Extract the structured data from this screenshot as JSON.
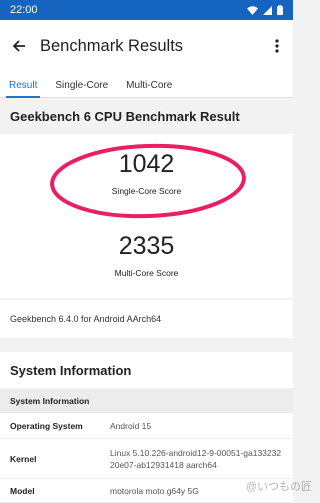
{
  "status_bar": {
    "time": "22:00"
  },
  "app_bar": {
    "title": "Benchmark Results"
  },
  "tabs": [
    {
      "label": "Result",
      "active": true
    },
    {
      "label": "Single-Core",
      "active": false
    },
    {
      "label": "Multi-Core",
      "active": false
    }
  ],
  "result": {
    "heading": "Geekbench 6 CPU Benchmark Result",
    "single_core": {
      "score": "1042",
      "label": "Single-Core Score"
    },
    "multi_core": {
      "score": "2335",
      "label": "Multi-Core Score"
    },
    "version": "Geekbench 6.4.0 for Android AArch64"
  },
  "system_info": {
    "title": "System Information",
    "subheader": "System Information",
    "rows": [
      {
        "key": "Operating System",
        "value": "Android 15"
      },
      {
        "key": "Kernel",
        "value": "Linux 5.10.226-android12-9-00051-ga13323220e07-ab12931418 aarch64"
      },
      {
        "key": "Model",
        "value": "motorola moto g64y 5G"
      }
    ]
  },
  "watermark": "@いつもの匠",
  "colors": {
    "status_bar": "#1565c0",
    "accent": "#1976d2",
    "highlight": "#e91e63"
  }
}
